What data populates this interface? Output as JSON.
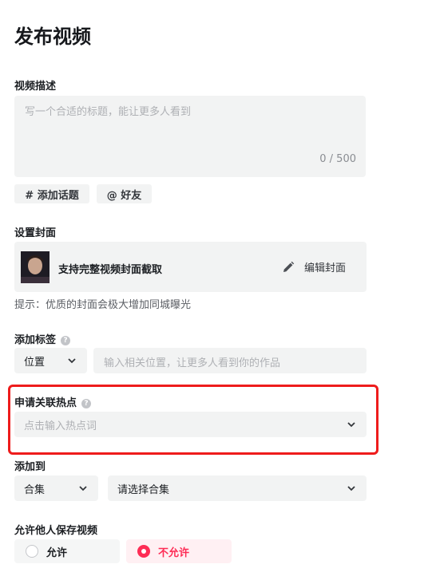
{
  "page": {
    "title": "发布视频"
  },
  "description": {
    "label": "视频描述",
    "placeholder": "写一个合适的标题，能让更多人看到",
    "counter": "0 / 500",
    "topic_button": "# 添加话题",
    "friend_button": "@ 好友"
  },
  "cover": {
    "label": "设置封面",
    "info_text": "支持完整视频封面截取",
    "edit_label": "编辑封面",
    "tip": "提示：优质的封面会极大增加同城曝光"
  },
  "tags": {
    "label": "添加标签",
    "type_value": "位置",
    "input_placeholder": "输入相关位置，让更多人看到你的作品"
  },
  "hotspot": {
    "label": "申请关联热点",
    "placeholder": "点击输入热点词"
  },
  "add_to": {
    "label": "添加到",
    "type_value": "合集",
    "collection_placeholder": "请选择合集"
  },
  "save_permission": {
    "label": "允许他人保存视频",
    "allow_label": "允许",
    "deny_label": "不允许",
    "selected": "deny"
  },
  "colors": {
    "accent": "#fe2c55",
    "highlight_border": "#ee1c1c",
    "field_bg": "#f2f3f3"
  }
}
